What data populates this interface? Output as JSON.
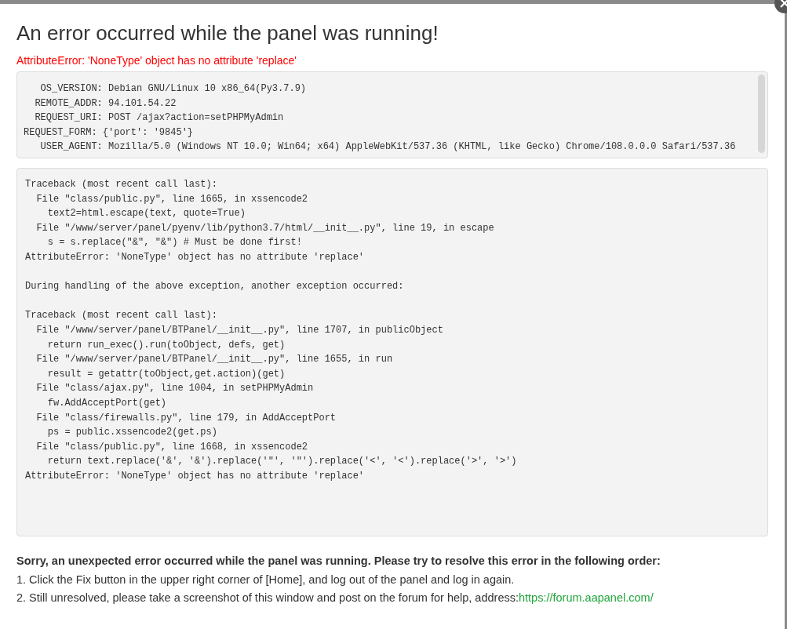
{
  "dialog": {
    "title": "An error occurred while the panel was running!",
    "error": "AttributeError: 'NoneType' object has no attribute 'replace'",
    "info_lines": [
      "   OS_VERSION: Debian GNU/Linux 10 x86_64(Py3.7.9)",
      "  REMOTE_ADDR: 94.101.54.22",
      "  REQUEST_URI: POST /ajax?action=setPHPMyAdmin",
      "REQUEST_FORM: {'port': '9845'}",
      "   USER_AGENT: Mozilla/5.0 (Windows NT 10.0; Win64; x64) AppleWebKit/537.36 (KHTML, like Gecko) Chrome/108.0.0.0 Safari/537.36"
    ],
    "traceback_blocks": [
      [
        "Traceback (most recent call last):",
        "  File \"class/public.py\", line 1665, in xssencode2",
        "    text2=html.escape(text, quote=True)",
        "  File \"/www/server/panel/pyenv/lib/python3.7/html/__init__.py\", line 19, in escape",
        "    s = s.replace(\"&\", \"&\") # Must be done first!",
        "AttributeError: 'NoneType' object has no attribute 'replace'"
      ],
      [
        "During handling of the above exception, another exception occurred:"
      ],
      [
        "Traceback (most recent call last):",
        "  File \"/www/server/panel/BTPanel/__init__.py\", line 1707, in publicObject",
        "    return run_exec().run(toObject, defs, get)",
        "  File \"/www/server/panel/BTPanel/__init__.py\", line 1655, in run",
        "    result = getattr(toObject,get.action)(get)",
        "  File \"class/ajax.py\", line 1004, in setPHPMyAdmin",
        "    fw.AddAcceptPort(get)",
        "  File \"class/firewalls.py\", line 179, in AddAcceptPort",
        "    ps = public.xssencode2(get.ps)",
        "  File \"class/public.py\", line 1668, in xssencode2",
        "    return text.replace('&', '&').replace('\"', '\"').replace('<', '<').replace('>', '>')",
        "AttributeError: 'NoneType' object has no attribute 'replace'"
      ]
    ],
    "help_heading": "Sorry, an unexpected error occurred while the panel was running. Please try to resolve this error in the following order:",
    "help_steps": [
      {
        "text": "1. Click the Fix button in the upper right corner of [Home], and log out of the panel and log in again."
      },
      {
        "text": "2. Still unresolved, please take a screenshot of this window and post on the forum for help, address:",
        "link": "https://forum.aapanel.com/"
      }
    ]
  }
}
